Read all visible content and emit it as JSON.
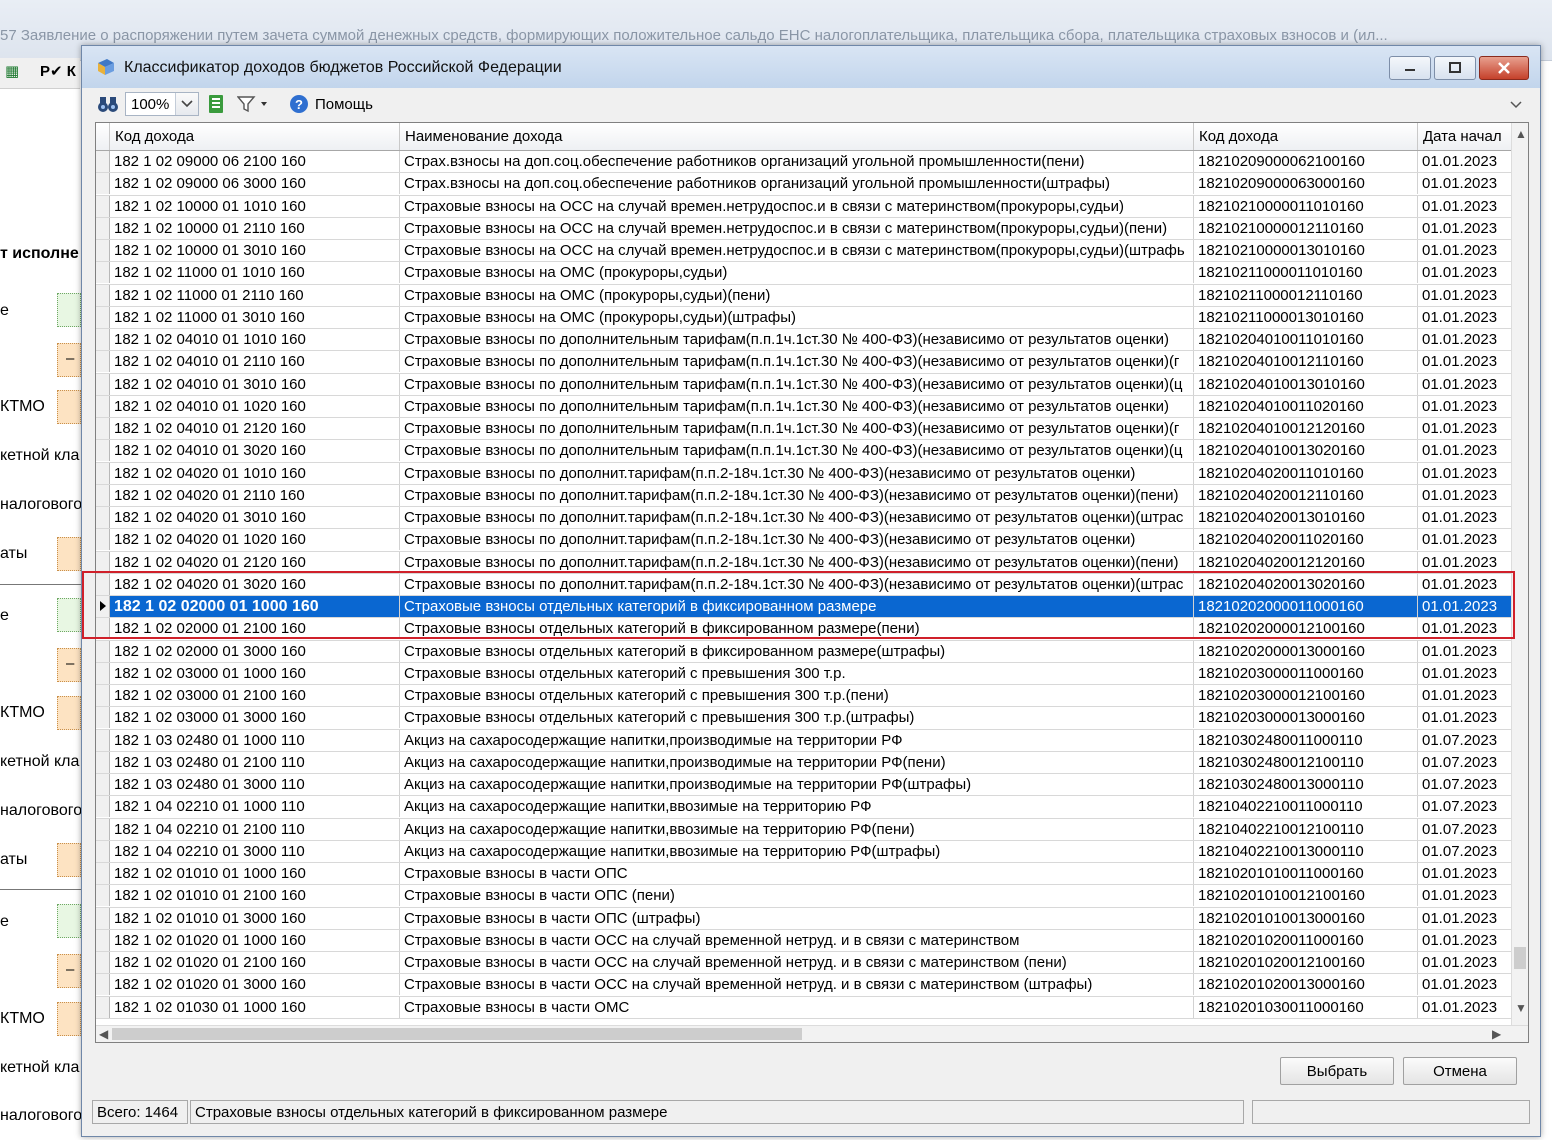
{
  "background_window": {
    "title": "57  Заявление о распоряжении путем зачета суммой денежных средств, формирующих положительное сальдо ЕНС налогоплательщика, плательщика сбора, плательщика страховых взносов и (ил...",
    "toolbar_text": "Р✔  К",
    "section_heading": "т исполне",
    "labels": [
      "е",
      "КТМО",
      "кетной кла",
      "налогового",
      "аты"
    ],
    "dash": "–"
  },
  "dialog": {
    "title": "Классификатор доходов бюджетов Российской Федерации",
    "toolbar": {
      "zoom": "100%",
      "help_label": "Помощь"
    },
    "columns": [
      "Код дохода",
      "Наименование дохода",
      "Код дохода",
      "Дата начал"
    ],
    "rows": [
      {
        "code": "182 1 02 09000 06 2100 160",
        "name": "Страх.взносы на доп.соц.обеспечение работников организаций угольной промышленности(пени)",
        "kod": "18210209000062100160",
        "date": "01.01.2023"
      },
      {
        "code": "182 1 02 09000 06 3000 160",
        "name": "Страх.взносы на доп.соц.обеспечение работников организаций угольной промышленности(штрафы)",
        "kod": "18210209000063000160",
        "date": "01.01.2023"
      },
      {
        "code": "182 1 02 10000 01 1010 160",
        "name": "Страховые взносы на ОСС на случай времен.нетрудоспос.и в связи с материнством(прокуроры,судьи)",
        "kod": "18210210000011010160",
        "date": "01.01.2023"
      },
      {
        "code": "182 1 02 10000 01 2110 160",
        "name": "Страховые взносы на ОСС на случай времен.нетрудоспос.и в связи с материнством(прокуроры,судьи)(пени)",
        "kod": "18210210000012110160",
        "date": "01.01.2023"
      },
      {
        "code": "182 1 02 10000 01 3010 160",
        "name": "Страховые взносы на ОСС на случай времен.нетрудоспос.и в связи с материнством(прокуроры,судьи)(штрафь",
        "kod": "18210210000013010160",
        "date": "01.01.2023"
      },
      {
        "code": "182 1 02 11000 01 1010 160",
        "name": "Страховые взносы на ОМС (прокуроры,судьи)",
        "kod": "18210211000011010160",
        "date": "01.01.2023"
      },
      {
        "code": "182 1 02 11000 01 2110 160",
        "name": "Страховые взносы на ОМС (прокуроры,судьи)(пени)",
        "kod": "18210211000012110160",
        "date": "01.01.2023"
      },
      {
        "code": "182 1 02 11000 01 3010 160",
        "name": "Страховые взносы на ОМС (прокуроры,судьи)(штрафы)",
        "kod": "18210211000013010160",
        "date": "01.01.2023"
      },
      {
        "code": "182 1 02 04010 01 1010 160",
        "name": "Страховые взносы по дополнительным тарифам(п.п.1ч.1ст.30 № 400-ФЗ)(независимо от результатов оценки)",
        "kod": "18210204010011010160",
        "date": "01.01.2023"
      },
      {
        "code": "182 1 02 04010 01 2110 160",
        "name": "Страховые взносы по дополнительным тарифам(п.п.1ч.1ст.30 № 400-ФЗ)(независимо от результатов оценки)(г",
        "kod": "18210204010012110160",
        "date": "01.01.2023"
      },
      {
        "code": "182 1 02 04010 01 3010 160",
        "name": "Страховые взносы по дополнительным тарифам(п.п.1ч.1ст.30 № 400-ФЗ)(независимо от результатов оценки)(ц",
        "kod": "18210204010013010160",
        "date": "01.01.2023"
      },
      {
        "code": "182 1 02 04010 01 1020 160",
        "name": "Страховые взносы по дополнительным тарифам(п.п.1ч.1ст.30 № 400-ФЗ)(независимо от результатов оценки)",
        "kod": "18210204010011020160",
        "date": "01.01.2023"
      },
      {
        "code": "182 1 02 04010 01 2120 160",
        "name": "Страховые взносы по дополнительным тарифам(п.п.1ч.1ст.30 № 400-ФЗ)(независимо от результатов оценки)(г",
        "kod": "18210204010012120160",
        "date": "01.01.2023"
      },
      {
        "code": "182 1 02 04010 01 3020 160",
        "name": "Страховые взносы по дополнительным тарифам(п.п.1ч.1ст.30 № 400-ФЗ)(независимо от результатов оценки)(ц",
        "kod": "18210204010013020160",
        "date": "01.01.2023"
      },
      {
        "code": "182 1 02 04020 01 1010 160",
        "name": "Страховые взносы по дополнит.тарифам(п.п.2-18ч.1ст.30 № 400-ФЗ)(независимо от результатов оценки)",
        "kod": "18210204020011010160",
        "date": "01.01.2023"
      },
      {
        "code": "182 1 02 04020 01 2110 160",
        "name": "Страховые взносы по дополнит.тарифам(п.п.2-18ч.1ст.30 № 400-ФЗ)(независимо от результатов оценки)(пени)",
        "kod": "18210204020012110160",
        "date": "01.01.2023"
      },
      {
        "code": "182 1 02 04020 01 3010 160",
        "name": "Страховые взносы по дополнит.тарифам(п.п.2-18ч.1ст.30 № 400-ФЗ)(независимо от результатов оценки)(штрас",
        "kod": "18210204020013010160",
        "date": "01.01.2023"
      },
      {
        "code": "182 1 02 04020 01 1020 160",
        "name": "Страховые взносы по дополнит.тарифам(п.п.2-18ч.1ст.30 № 400-ФЗ)(независимо от результатов оценки)",
        "kod": "18210204020011020160",
        "date": "01.01.2023"
      },
      {
        "code": "182 1 02 04020 01 2120 160",
        "name": "Страховые взносы по дополнит.тарифам(п.п.2-18ч.1ст.30 № 400-ФЗ)(независимо от результатов оценки)(пени)",
        "kod": "18210204020012120160",
        "date": "01.01.2023"
      },
      {
        "code": "182 1 02 04020 01 3020 160",
        "name": "Страховые взносы по дополнит.тарифам(п.п.2-18ч.1ст.30 № 400-ФЗ)(независимо от результатов оценки)(штрас",
        "kod": "18210204020013020160",
        "date": "01.01.2023"
      },
      {
        "code": "182 1 02 02000 01 1000 160",
        "name": "Страховые взносы отдельных категорий в фиксированном размере",
        "kod": "18210202000011000160",
        "date": "01.01.2023",
        "selected": true
      },
      {
        "code": "182 1 02 02000 01 2100 160",
        "name": "Страховые взносы отдельных категорий в фиксированном размере(пени)",
        "kod": "18210202000012100160",
        "date": "01.01.2023"
      },
      {
        "code": "182 1 02 02000 01 3000 160",
        "name": "Страховые взносы отдельных категорий в фиксированном размере(штрафы)",
        "kod": "18210202000013000160",
        "date": "01.01.2023"
      },
      {
        "code": "182 1 02 03000 01 1000 160",
        "name": "Страховые взносы отдельных категорий с превышения 300 т.р.",
        "kod": "18210203000011000160",
        "date": "01.01.2023"
      },
      {
        "code": "182 1 02 03000 01 2100 160",
        "name": "Страховые взносы отдельных категорий с превышения 300 т.р.(пени)",
        "kod": "18210203000012100160",
        "date": "01.01.2023"
      },
      {
        "code": "182 1 02 03000 01 3000 160",
        "name": "Страховые взносы отдельных категорий с превышения 300 т.р.(штрафы)",
        "kod": "18210203000013000160",
        "date": "01.01.2023"
      },
      {
        "code": "182 1 03 02480 01 1000 110",
        "name": "Акциз на сахаросодержащие напитки,производимые на территории РФ",
        "kod": "18210302480011000110",
        "date": "01.07.2023"
      },
      {
        "code": "182 1 03 02480 01 2100 110",
        "name": "Акциз на сахаросодержащие напитки,производимые на территории РФ(пени)",
        "kod": "18210302480012100110",
        "date": "01.07.2023"
      },
      {
        "code": "182 1 03 02480 01 3000 110",
        "name": "Акциз на сахаросодержащие напитки,производимые на территории РФ(штрафы)",
        "kod": "18210302480013000110",
        "date": "01.07.2023"
      },
      {
        "code": "182 1 04 02210 01 1000 110",
        "name": "Акциз на сахаросодержащие напитки,ввозимые на территорию РФ",
        "kod": "18210402210011000110",
        "date": "01.07.2023"
      },
      {
        "code": "182 1 04 02210 01 2100 110",
        "name": "Акциз на сахаросодержащие напитки,ввозимые на территорию РФ(пени)",
        "kod": "18210402210012100110",
        "date": "01.07.2023"
      },
      {
        "code": "182 1 04 02210 01 3000 110",
        "name": "Акциз на сахаросодержащие напитки,ввозимые на территорию РФ(штрафы)",
        "kod": "18210402210013000110",
        "date": "01.07.2023"
      },
      {
        "code": "182 1 02 01010 01 1000 160",
        "name": "Страховые взносы в части ОПС",
        "kod": "18210201010011000160",
        "date": "01.01.2023"
      },
      {
        "code": "182 1 02 01010 01 2100 160",
        "name": "Страховые взносы в части ОПС (пени)",
        "kod": "18210201010012100160",
        "date": "01.01.2023"
      },
      {
        "code": "182 1 02 01010 01 3000 160",
        "name": "Страховые взносы в части ОПС (штрафы)",
        "kod": "18210201010013000160",
        "date": "01.01.2023"
      },
      {
        "code": "182 1 02 01020 01 1000 160",
        "name": "Страховые взносы в части ОСС на случай временной нетруд. и в связи с материнством",
        "kod": "18210201020011000160",
        "date": "01.01.2023"
      },
      {
        "code": "182 1 02 01020 01 2100 160",
        "name": "Страховые взносы в части ОСС на случай временной нетруд. и в связи с материнством (пени)",
        "kod": "18210201020012100160",
        "date": "01.01.2023"
      },
      {
        "code": "182 1 02 01020 01 3000 160",
        "name": "Страховые взносы в части ОСС на случай временной нетруд. и в связи с материнством (штрафы)",
        "kod": "18210201020013000160",
        "date": "01.01.2023"
      },
      {
        "code": "182 1 02 01030 01 1000 160",
        "name": "Страховые взносы в части ОМС",
        "kod": "18210201030011000160",
        "date": "01.01.2023"
      }
    ],
    "buttons": {
      "select": "Выбрать",
      "cancel": "Отмена"
    },
    "status": {
      "total": "Всего: 1464",
      "current": "Страховые взносы отдельных категорий в фиксированном размере",
      "extra": ""
    }
  },
  "colors": {
    "selection": "#0a67d1",
    "highlight_frame": "#d0202a",
    "titlebar": "#c2d5ec"
  }
}
